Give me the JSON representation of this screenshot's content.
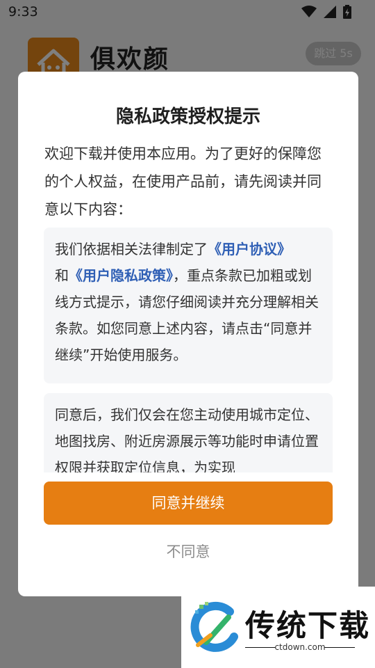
{
  "status_bar": {
    "time": "9:33"
  },
  "app": {
    "name": "俱欢颜",
    "skip_label": "跳过 5s",
    "logo_icon": "house-icon",
    "brand_color": "#e8891a"
  },
  "dialog": {
    "title": "隐私政策授权提示",
    "intro": "欢迎下载并使用本应用。为了更好的保障您的个人权益，在使用产品前，请先阅读并同意以下内容：",
    "box1": {
      "prefix": "我们依据相关法律制定了",
      "link1": "《用户协议》",
      "conj": "和",
      "link2": "《用户隐私政策》",
      "suffix": "，重点条款已加粗或划线方式提示，请您仔细阅读并充分理解相关条款。如您同意上述内容，请点击“同意并继续”开始使用服务。"
    },
    "box2": {
      "text": "同意后，我们仅会在您主动使用城市定位、地图找房、附近房源展示等功能时申请位置权限并获取定位信息，为实现"
    },
    "agree_label": "同意并继续",
    "disagree_label": "不同意",
    "accent_color": "#e67e12",
    "link_color": "#2f5fb5"
  },
  "watermark": {
    "title": "传统下载",
    "subtitle": "ctdown.com"
  }
}
